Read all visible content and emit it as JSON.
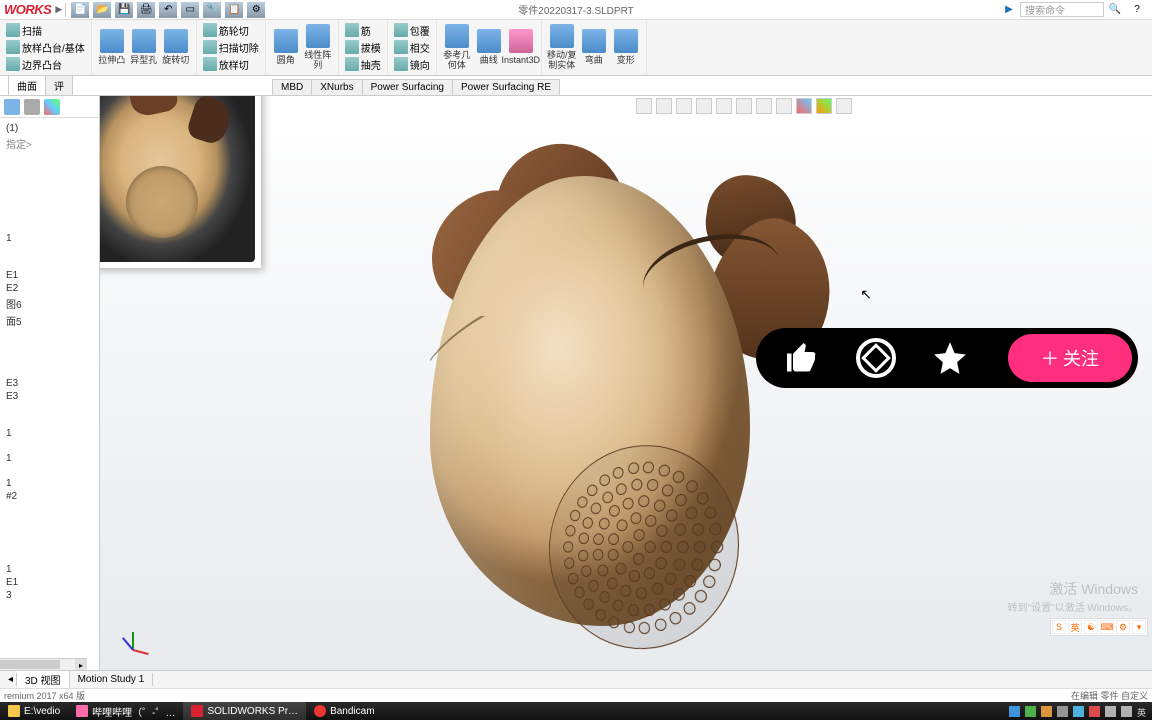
{
  "app": {
    "logo_text": "WORKS",
    "doc_title": "零件20220317-3.SLDPRT",
    "search_placeholder": "搜索命令"
  },
  "titlebar_icons": [
    "new-icon",
    "open-dropdown-icon",
    "save-dropdown-icon",
    "print-dropdown-icon",
    "undo-dropdown-icon",
    "select-dropdown-icon",
    "rebuild-icon",
    "options-icon",
    "settings-dropdown-icon"
  ],
  "ribbon": {
    "g1": [
      "扫描",
      "放样凸台/基体",
      "边界凸台"
    ],
    "g2_big": [
      "拉伸凸",
      "异型孔",
      "旋转切",
      "筋轮切",
      "扫描切除",
      "放样切",
      "线性阵"
    ],
    "g3_big": [
      "圆角",
      "线性阵列"
    ],
    "g4": [
      "筋",
      "拔模",
      "抽壳"
    ],
    "g5": [
      "包覆",
      "相交",
      "镜向"
    ],
    "g6_big": [
      "参考几何体",
      "曲线",
      "Instant3D"
    ],
    "g7_big": [
      "移动/复制实体",
      "弯曲",
      "变形"
    ]
  },
  "tabs": [
    "曲面",
    "评",
    "MBD",
    "XNurbs",
    "Power Surfacing",
    "Power Surfacing RE"
  ],
  "left_panel": {
    "header1": "(1)",
    "header2": "指定>",
    "items": [
      "1",
      "E1",
      "E2",
      "图6",
      "面5",
      "E3",
      "E3",
      "1",
      "1",
      "1",
      "#2",
      "1",
      "E1",
      "3"
    ]
  },
  "viewport_icons": [
    "zoom-fit-icon",
    "zoom-area-icon",
    "rotate-icon",
    "section-icon",
    "display-style-icon",
    "scene-icon",
    "view-orient-icon",
    "hide-show-icon",
    "appearance-icon",
    "render-icon",
    "screen-icon"
  ],
  "pill": {
    "follow": "关注"
  },
  "bottom_tabs": [
    "",
    "3D 视图",
    "Motion Study 1"
  ],
  "status": {
    "left": "remium 2017 x64 版",
    "right": "在编辑 零件    自定义"
  },
  "activate": {
    "line1": "激活 Windows",
    "line2": "转到\"设置\"以激活 Windows。"
  },
  "ime": [
    "S",
    "英",
    "",
    "",
    "",
    ""
  ],
  "taskbar": {
    "items": [
      {
        "label": "E:\\vedio",
        "color": "#f5c84b"
      },
      {
        "label": "哔哩哔哩（゜-゜…",
        "color": "#ff6aa8"
      },
      {
        "label": "SOLIDWORKS Pr…",
        "color": "#d92231"
      },
      {
        "label": "Bandicam",
        "color": "#e33"
      }
    ]
  }
}
